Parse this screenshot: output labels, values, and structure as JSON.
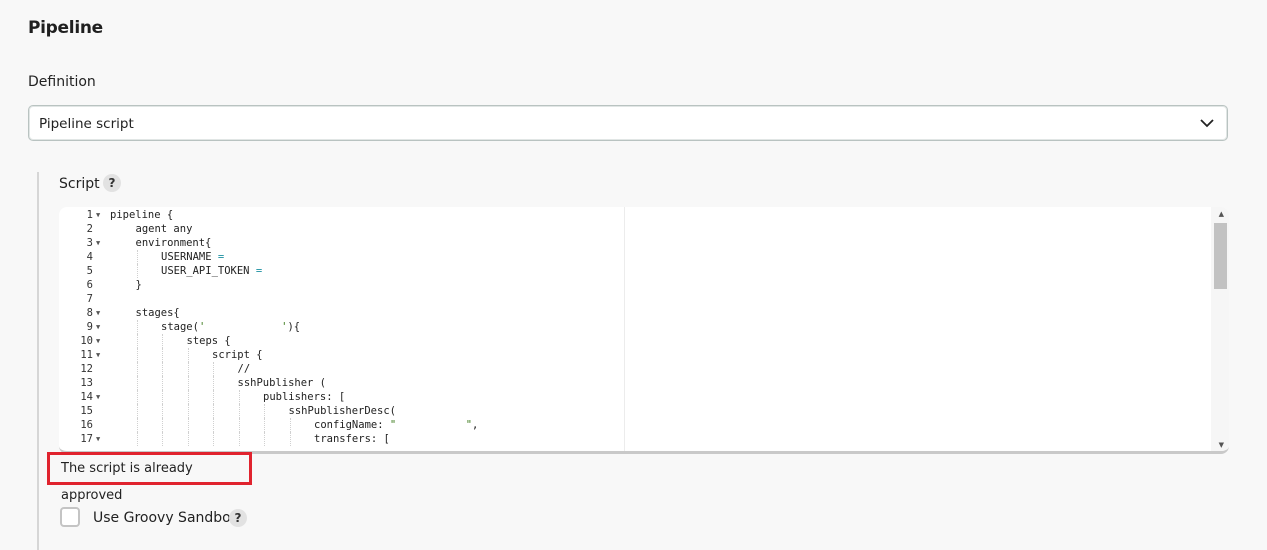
{
  "section": {
    "title": "Pipeline"
  },
  "definition": {
    "label": "Definition",
    "selected": "Pipeline script"
  },
  "script": {
    "label": "Script",
    "help": "?",
    "lines": [
      {
        "n": "1",
        "fold": true,
        "indent": 0,
        "parts": [
          {
            "t": "pipeline {"
          }
        ]
      },
      {
        "n": "2",
        "fold": false,
        "indent": 1,
        "parts": [
          {
            "t": "agent any"
          }
        ]
      },
      {
        "n": "3",
        "fold": true,
        "indent": 1,
        "parts": [
          {
            "t": "environment{"
          }
        ]
      },
      {
        "n": "4",
        "fold": false,
        "indent": 2,
        "parts": [
          {
            "t": "USERNAME "
          },
          {
            "t": "=",
            "c": "op"
          }
        ]
      },
      {
        "n": "5",
        "fold": false,
        "indent": 2,
        "parts": [
          {
            "t": "USER_API_TOKEN "
          },
          {
            "t": "=",
            "c": "op"
          }
        ]
      },
      {
        "n": "6",
        "fold": false,
        "indent": 1,
        "parts": [
          {
            "t": "}"
          }
        ]
      },
      {
        "n": "7",
        "fold": false,
        "indent": 0,
        "parts": [
          {
            "t": ""
          }
        ]
      },
      {
        "n": "8",
        "fold": true,
        "indent": 1,
        "parts": [
          {
            "t": "stages{"
          }
        ]
      },
      {
        "n": "9",
        "fold": true,
        "indent": 2,
        "parts": [
          {
            "t": "stage("
          },
          {
            "t": "'            '",
            "c": "str"
          },
          {
            "t": "){"
          }
        ]
      },
      {
        "n": "10",
        "fold": true,
        "indent": 3,
        "parts": [
          {
            "t": "steps {"
          }
        ]
      },
      {
        "n": "11",
        "fold": true,
        "indent": 4,
        "parts": [
          {
            "t": "script {"
          }
        ]
      },
      {
        "n": "12",
        "fold": false,
        "indent": 5,
        "parts": [
          {
            "t": "//"
          }
        ]
      },
      {
        "n": "13",
        "fold": false,
        "indent": 5,
        "parts": [
          {
            "t": "sshPublisher ("
          }
        ]
      },
      {
        "n": "14",
        "fold": true,
        "indent": 6,
        "parts": [
          {
            "t": "publishers: ["
          }
        ]
      },
      {
        "n": "15",
        "fold": false,
        "indent": 7,
        "parts": [
          {
            "t": "sshPublisherDesc("
          }
        ]
      },
      {
        "n": "16",
        "fold": false,
        "indent": 8,
        "parts": [
          {
            "t": "configName: "
          },
          {
            "t": "\"           \"",
            "c": "str"
          },
          {
            "t": ","
          }
        ]
      },
      {
        "n": "17",
        "fold": true,
        "indent": 8,
        "parts": [
          {
            "t": "transfers: ["
          }
        ]
      }
    ]
  },
  "approval": {
    "message": "The script is already approved"
  },
  "sandbox": {
    "label": "Use Groovy Sandbox",
    "checked": false,
    "help": "?"
  },
  "colors": {
    "highlight": "#e0232e",
    "string": "#3a7a1a",
    "operator": "#1a8fa0"
  },
  "icons": {
    "select_chevron": "chevron-down-icon",
    "help": "question-mark-icon"
  }
}
